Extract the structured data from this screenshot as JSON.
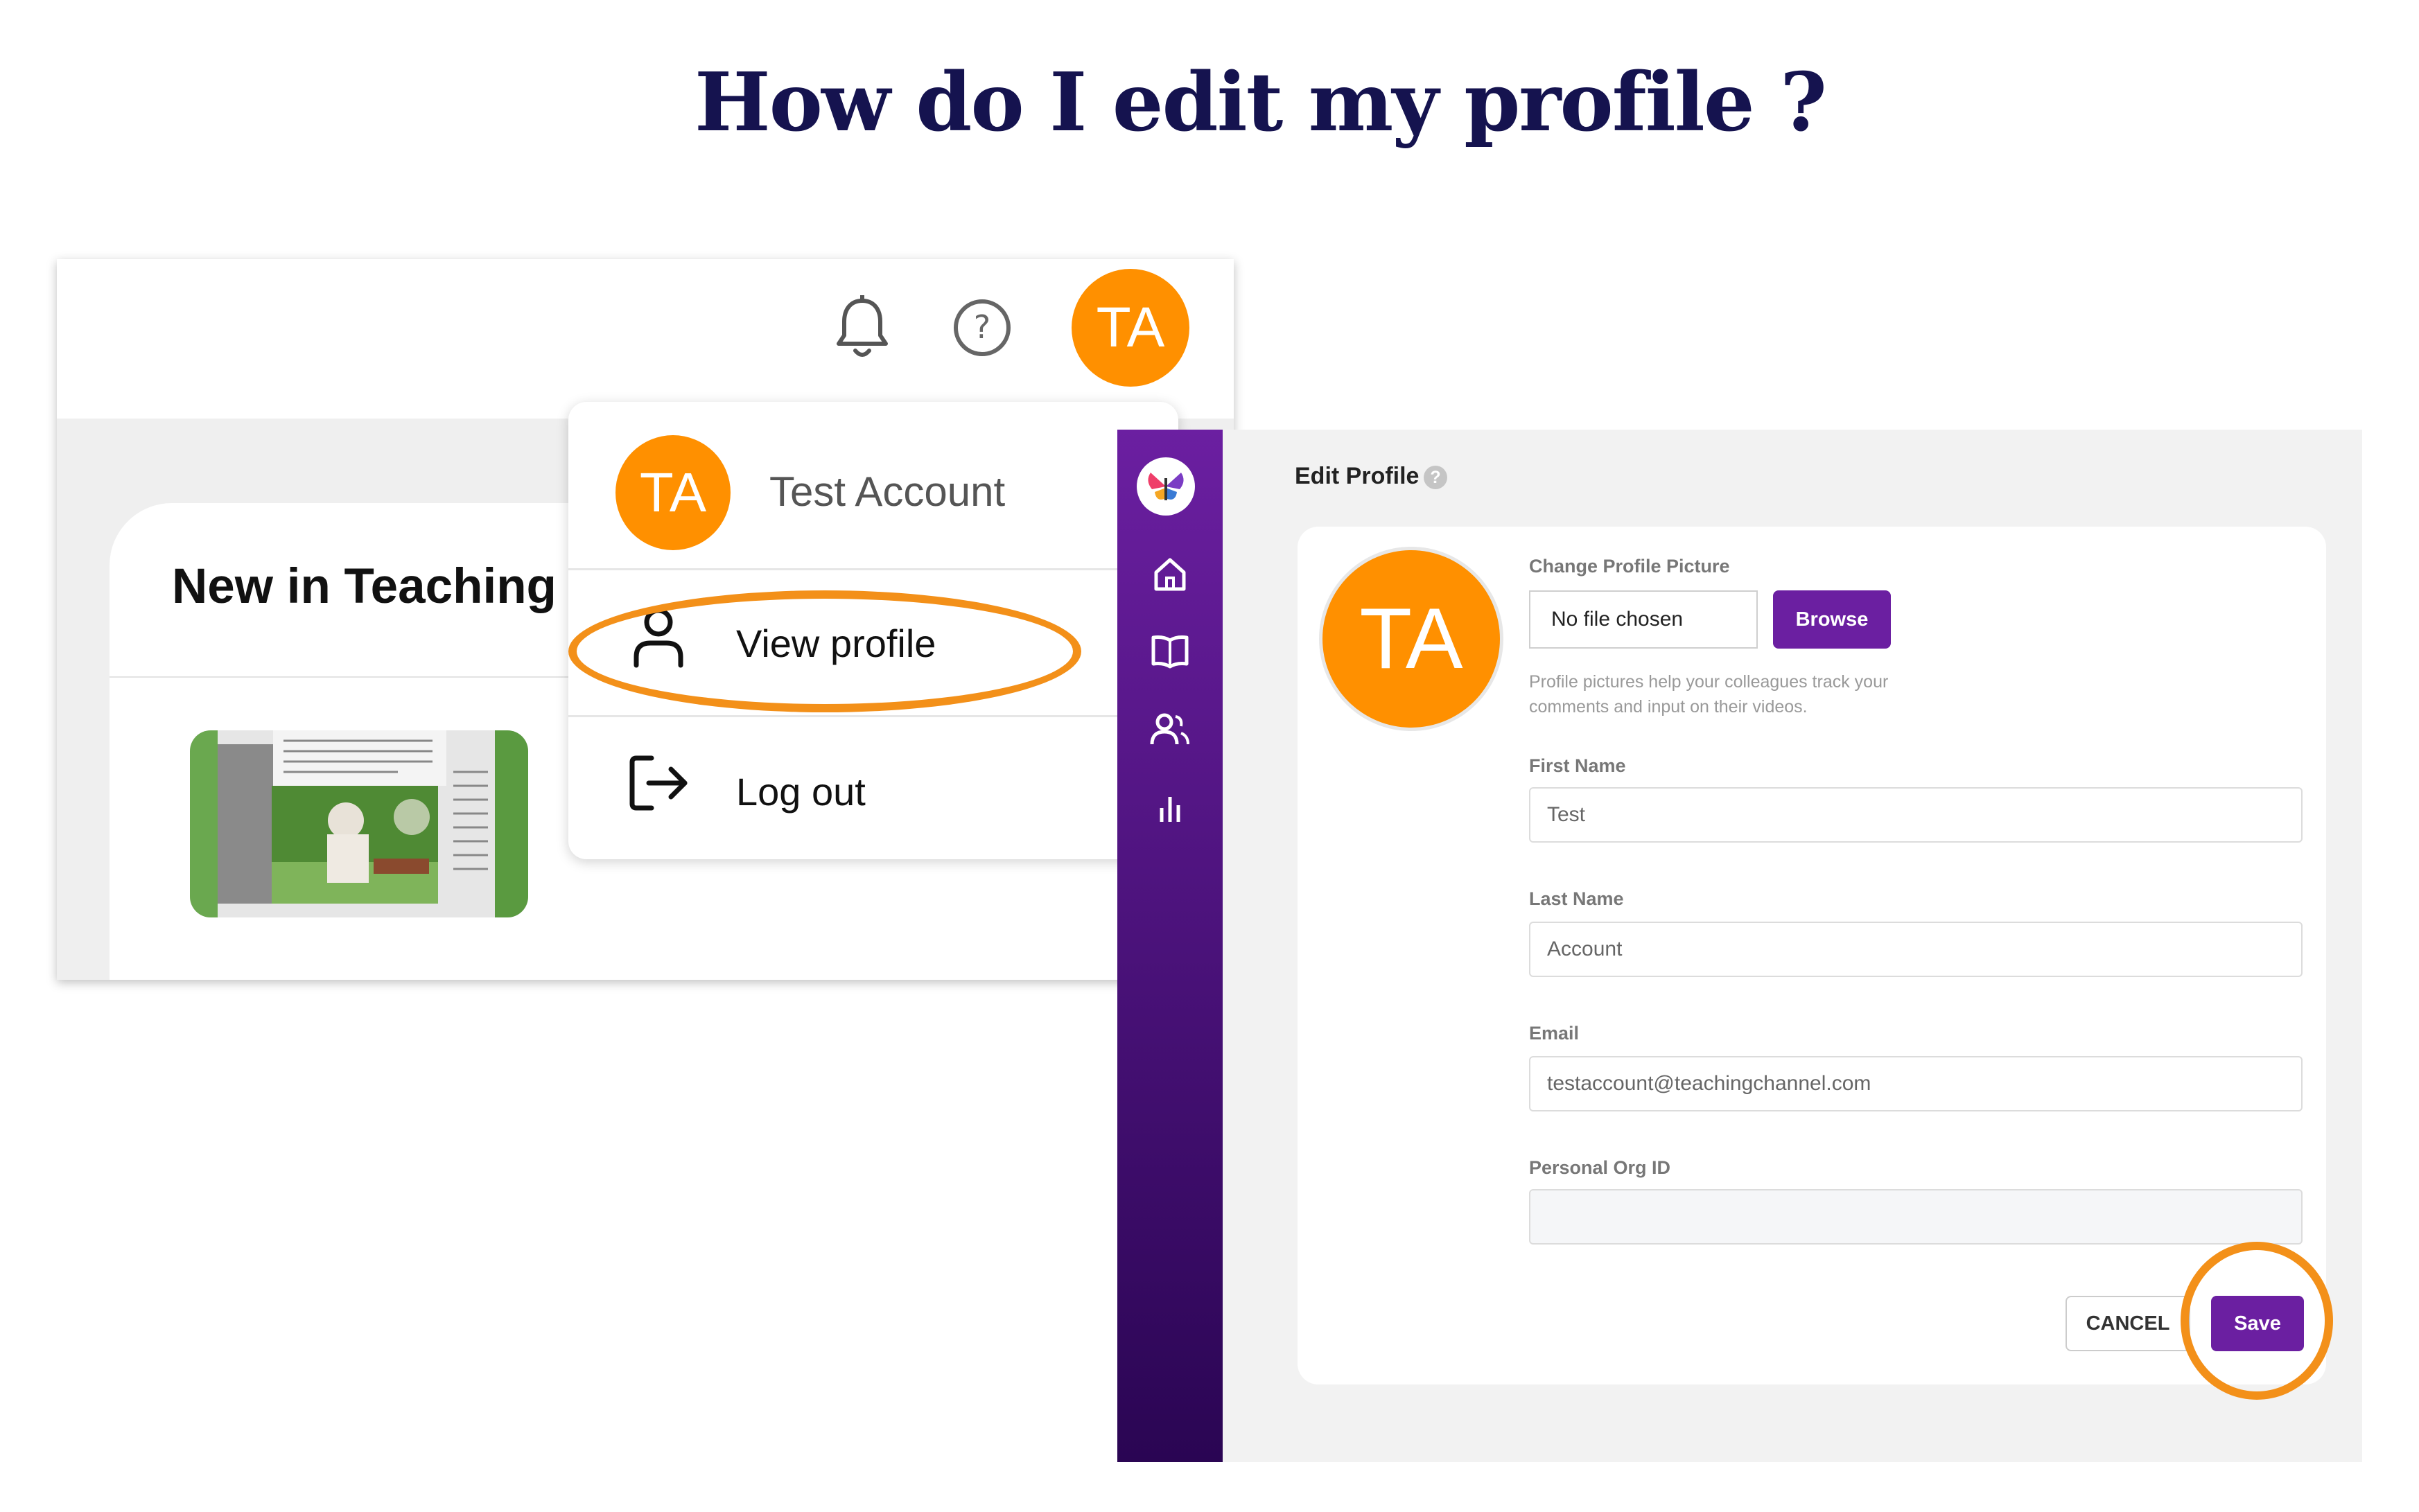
{
  "title": "How do I edit my profile ?",
  "top_bar": {
    "avatar_initials": "TA",
    "icons": [
      "bell-icon",
      "help-icon"
    ]
  },
  "card": {
    "title": "New in Teaching C"
  },
  "dropdown": {
    "avatar_initials": "TA",
    "name": "Test Account",
    "items": [
      {
        "label": "View profile",
        "icon": "user-icon"
      },
      {
        "label": "Log out",
        "icon": "logout-icon"
      }
    ]
  },
  "sidebar": {
    "icons": [
      "logo-icon",
      "home-icon",
      "book-icon",
      "users-icon",
      "chart-icon"
    ]
  },
  "edit_profile": {
    "title": "Edit Profile",
    "help_glyph": "?",
    "avatar_initials": "TA",
    "change_picture_label": "Change Profile Picture",
    "file_value": "No file chosen",
    "browse_label": "Browse",
    "help_text": "Profile pictures help your colleagues track your comments and input on their videos.",
    "fields": [
      {
        "label": "First Name",
        "value": "Test"
      },
      {
        "label": "Last Name",
        "value": "Account"
      },
      {
        "label": "Email",
        "value": "testaccount@teachingchannel.com"
      },
      {
        "label": "Personal Org ID",
        "value": ""
      }
    ],
    "cancel_label": "CANCEL",
    "save_label": "Save"
  },
  "colors": {
    "accent_orange": "#ff9000",
    "highlight_orange": "#f39019",
    "purple": "#6b1fa1",
    "title_navy": "#15134f"
  }
}
